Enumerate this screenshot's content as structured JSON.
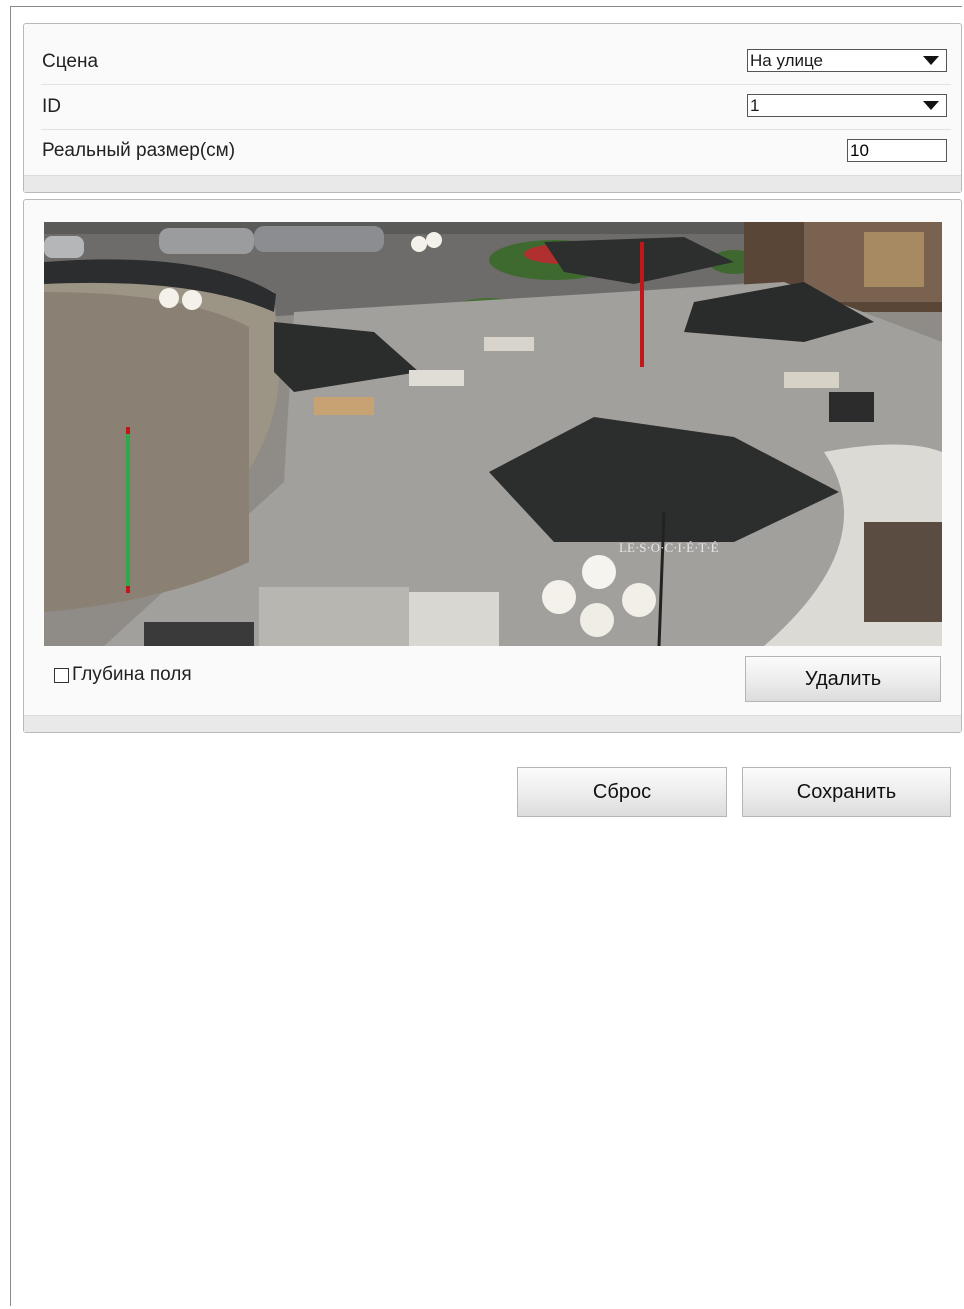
{
  "settings": {
    "scene_label": "Сцена",
    "scene_value": "На улице",
    "id_label": "ID",
    "id_value": "1",
    "real_size_label": "Реальный размер(см)",
    "real_size_value": "10"
  },
  "video": {
    "depth_of_field_label": "Глубина поля",
    "depth_of_field_checked": false,
    "delete_label": "Удалить",
    "umbrella_text": "LE·S·O·C·I·É·T·É",
    "marker_colors": {
      "left": "#2fa84a",
      "right": "#c01818"
    }
  },
  "actions": {
    "reset_label": "Сброс",
    "save_label": "Сохранить"
  }
}
